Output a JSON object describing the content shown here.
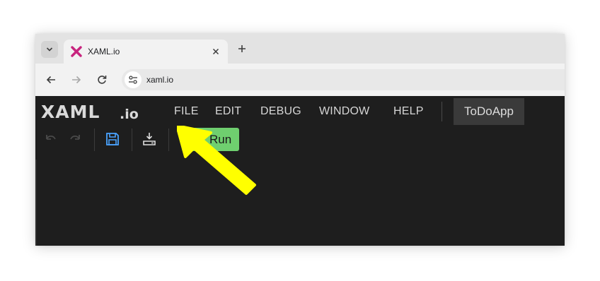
{
  "browser": {
    "tab": {
      "title": "XAML.io",
      "favicon": "xaml-x-icon"
    },
    "tab_menu_icon": "chevron-down-icon",
    "close_icon": "close-icon",
    "new_tab_icon": "plus-icon",
    "nav": {
      "back": "arrow-left-icon",
      "forward": "arrow-right-icon",
      "reload": "reload-icon"
    },
    "address": {
      "url": "xaml.io",
      "site_info_icon": "tune-icon"
    }
  },
  "app": {
    "logo": {
      "text": "XAML",
      "suffix": ".io"
    },
    "menu": [
      "FILE",
      "EDIT",
      "DEBUG",
      "WINDOW",
      "HELP"
    ],
    "project_name": "ToDoApp",
    "toolbar": {
      "undo_icon": "undo-icon",
      "redo_icon": "redo-icon",
      "save_icon": "save-icon",
      "download_icon": "download-icon",
      "run_label": "Run",
      "run_icon": "play-icon"
    }
  },
  "annotation": {
    "arrow_color": "#ffff00",
    "target": "run-button"
  },
  "colors": {
    "run_button": "#6fcf6f",
    "app_background": "#1e1e1e",
    "save_icon": "#4aa3ff"
  }
}
